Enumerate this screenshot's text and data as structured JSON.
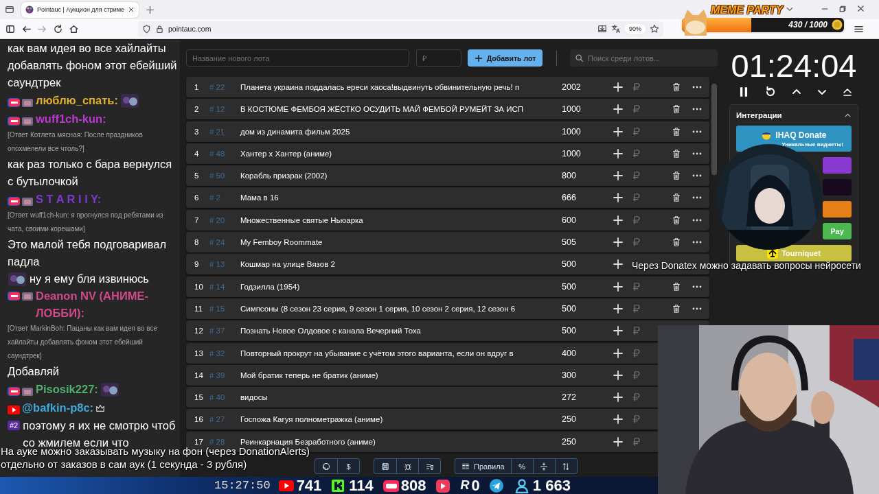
{
  "browser": {
    "tab": {
      "title": "Pointauc | Аукцион для стриме",
      "selected": true
    },
    "address": "pointauc.com",
    "zoom": "90%"
  },
  "meme_party": {
    "title": "MEME PARTY",
    "progress": "430 / 1000",
    "level": 0.43
  },
  "chat": [
    {
      "kind": "text",
      "parts": [
        "как вам идея во все хайлайты добавлять фоном этот ебейший саундтрек"
      ]
    },
    {
      "kind": "liveuser",
      "name": "люблю_спать:",
      "color": "#e0b030",
      "emote": true
    },
    {
      "kind": "liveuser",
      "name": "wuff1ch-kun:",
      "color": "#b83ad0",
      "emote": false
    },
    {
      "kind": "reply",
      "text": "[Ответ Котлета мясная: После праздников опохмелели все чтоль?]"
    },
    {
      "kind": "text",
      "parts": [
        "как раз только с бара вернулся с бутылочкой"
      ]
    },
    {
      "kind": "liveuser",
      "name": "S T A R I I Y:",
      "color": "#7a3ad0",
      "emote": false
    },
    {
      "kind": "reply",
      "text": "[Ответ wuff1ch-kun: я прогнулся под ребятами из чата, своими корешами]"
    },
    {
      "kind": "text",
      "parts": [
        "Это малой тебя подговаривал падла",
        "ну я ему бля извинюсь"
      ]
    },
    {
      "kind": "liveuser",
      "name": "Deanon NV (АНИМЕ-ЛОББИ):",
      "color": "#d04a8a",
      "emote": false
    },
    {
      "kind": "reply",
      "text": "[Ответ MarkinBoh: Пацаны как вам идея во все хайлайты добавлять фоном этот ебейший саундтрек]"
    },
    {
      "kind": "text",
      "parts": [
        "Добавляй"
      ]
    },
    {
      "kind": "liveuser",
      "name": "Pisosik227:",
      "color": "#50b070",
      "emote": true
    },
    {
      "kind": "ytuser",
      "name": "@bafkin-p8c:",
      "color": "#40a8d8",
      "emote": false,
      "crown": true
    },
    {
      "kind": "text",
      "badge": "#2",
      "parts": [
        "поэтому я их не смотрю чтоб со жмилем если что"
      ]
    }
  ],
  "auction": {
    "lot_name_placeholder": "Название нового лота",
    "amount_placeholder": "₽",
    "add_button": "Добавить лот",
    "search_placeholder": "Поиск среди лотов...",
    "lots": [
      {
        "kind": "full",
        "index": "1",
        "id": "# 22",
        "title": "Планета украина поддалась ереси хаоса!выдвинуть обвинительную речь! п",
        "amount": "2002"
      },
      {
        "kind": "full",
        "index": "2",
        "id": "# 12",
        "title": "В КОСТЮМЕ ФЕМБОЯ ЖЁСТКО ОСУДИТЬ МАЙ ФЕМБОЙ РУМЕЙТ ЗА ИСП",
        "amount": "1000"
      },
      {
        "kind": "full",
        "index": "3",
        "id": "# 21",
        "title": "дом из динамита фильм 2025",
        "amount": "1000"
      },
      {
        "kind": "full",
        "index": "4",
        "id": "# 48",
        "title": "Хантер х Хантер (аниме)",
        "amount": "1000"
      },
      {
        "kind": "full",
        "index": "5",
        "id": "# 50",
        "title": "Корабль призрак (2002)",
        "amount": "800"
      },
      {
        "kind": "full",
        "index": "6",
        "id": "# 2",
        "title": "Мама в 16",
        "amount": "666"
      },
      {
        "kind": "full",
        "index": "7",
        "id": "# 20",
        "title": "Множественные святые Ньюарка",
        "amount": "600"
      },
      {
        "kind": "full",
        "index": "8",
        "id": "# 24",
        "title": "My Femboy Roommate",
        "amount": "505"
      },
      {
        "kind": "minimal",
        "index": "9",
        "id": "# 13",
        "title": "Кошмар на улице Вязов 2",
        "amount": "500"
      },
      {
        "kind": "full",
        "index": "10",
        "id": "# 14",
        "title": "Годзилла (1954)",
        "amount": "500"
      },
      {
        "kind": "full",
        "index": "11",
        "id": "# 15",
        "title": "Симпсоны (8 сезон 23 серия, 9 сезон 1 серия, 10 сезон 2 серия, 12 сезон 6",
        "amount": "500"
      },
      {
        "kind": "partial",
        "index": "12",
        "id": "# 37",
        "title": "Познать Новое Олдовое с канала Вечерний Тоха",
        "amount": "500"
      },
      {
        "kind": "partial",
        "index": "13",
        "id": "# 32",
        "title": "Повторный прокрут на убывание с учётом этого варианта, если он вдруг в",
        "amount": "400"
      },
      {
        "kind": "partial",
        "index": "14",
        "id": "# 39",
        "title": "Мой братик теперь не братик (аниме)",
        "amount": "300"
      },
      {
        "kind": "partial",
        "index": "15",
        "id": "# 40",
        "title": "видосы",
        "amount": "272"
      },
      {
        "kind": "partial",
        "index": "16",
        "id": "# 27",
        "title": "Госпожа Кагуя полнометражка (аниме)",
        "amount": "250"
      },
      {
        "kind": "partial",
        "index": "17",
        "id": "# 28",
        "title": "Реинкарнация Безработного (аниме)",
        "amount": "250"
      }
    ]
  },
  "timer": {
    "time": "01:24:04"
  },
  "integrations": {
    "title": "Интеграции",
    "expanded": true,
    "items": [
      {
        "kind": "ihaq",
        "label": "IHAQ Donate",
        "subtitle": "Уникальные виджеты!",
        "color": "#2e93c0"
      },
      {
        "kind": "plain",
        "color": "#8a3ad0"
      },
      {
        "kind": "plain",
        "color": "#1a0a20"
      },
      {
        "kind": "plain",
        "color": "#e8801a"
      },
      {
        "kind": "plain",
        "label": "Pay",
        "color": "#4cb850"
      },
      {
        "kind": "tourniquet",
        "label": "Tourniquet",
        "color": "#c8c040"
      }
    ]
  },
  "captions": {
    "donatex": "Через Donatex можно задавать вопросы нейросети",
    "music": [
      "На ауке можно заказывать музыку на фон (через DonationAlerts)",
      "отдельно от заказов в сам аук (1 секунда - 3 рубля)"
    ]
  },
  "toolbar": [
    [
      {
        "kind": "icon"
      },
      {
        "kind": "text",
        "label": "$"
      }
    ],
    [
      {
        "kind": "icon"
      },
      {
        "kind": "icon"
      },
      {
        "kind": "icon"
      }
    ],
    [
      {
        "kind": "icontext",
        "label": "Правила"
      },
      {
        "kind": "text",
        "label": "%"
      },
      {
        "kind": "icon"
      },
      {
        "kind": "icon"
      }
    ]
  ],
  "status_bar": {
    "time": "15:27:50",
    "stats": [
      {
        "kind": "youtube",
        "count": "741"
      },
      {
        "kind": "kick",
        "count": "114"
      },
      {
        "kind": "live",
        "count": "808"
      },
      {
        "kind": "rutube"
      },
      {
        "kind": "letter",
        "mark": "R",
        "count": "0"
      },
      {
        "kind": "telegram"
      },
      {
        "kind": "viewers",
        "count": "1 663"
      }
    ]
  }
}
